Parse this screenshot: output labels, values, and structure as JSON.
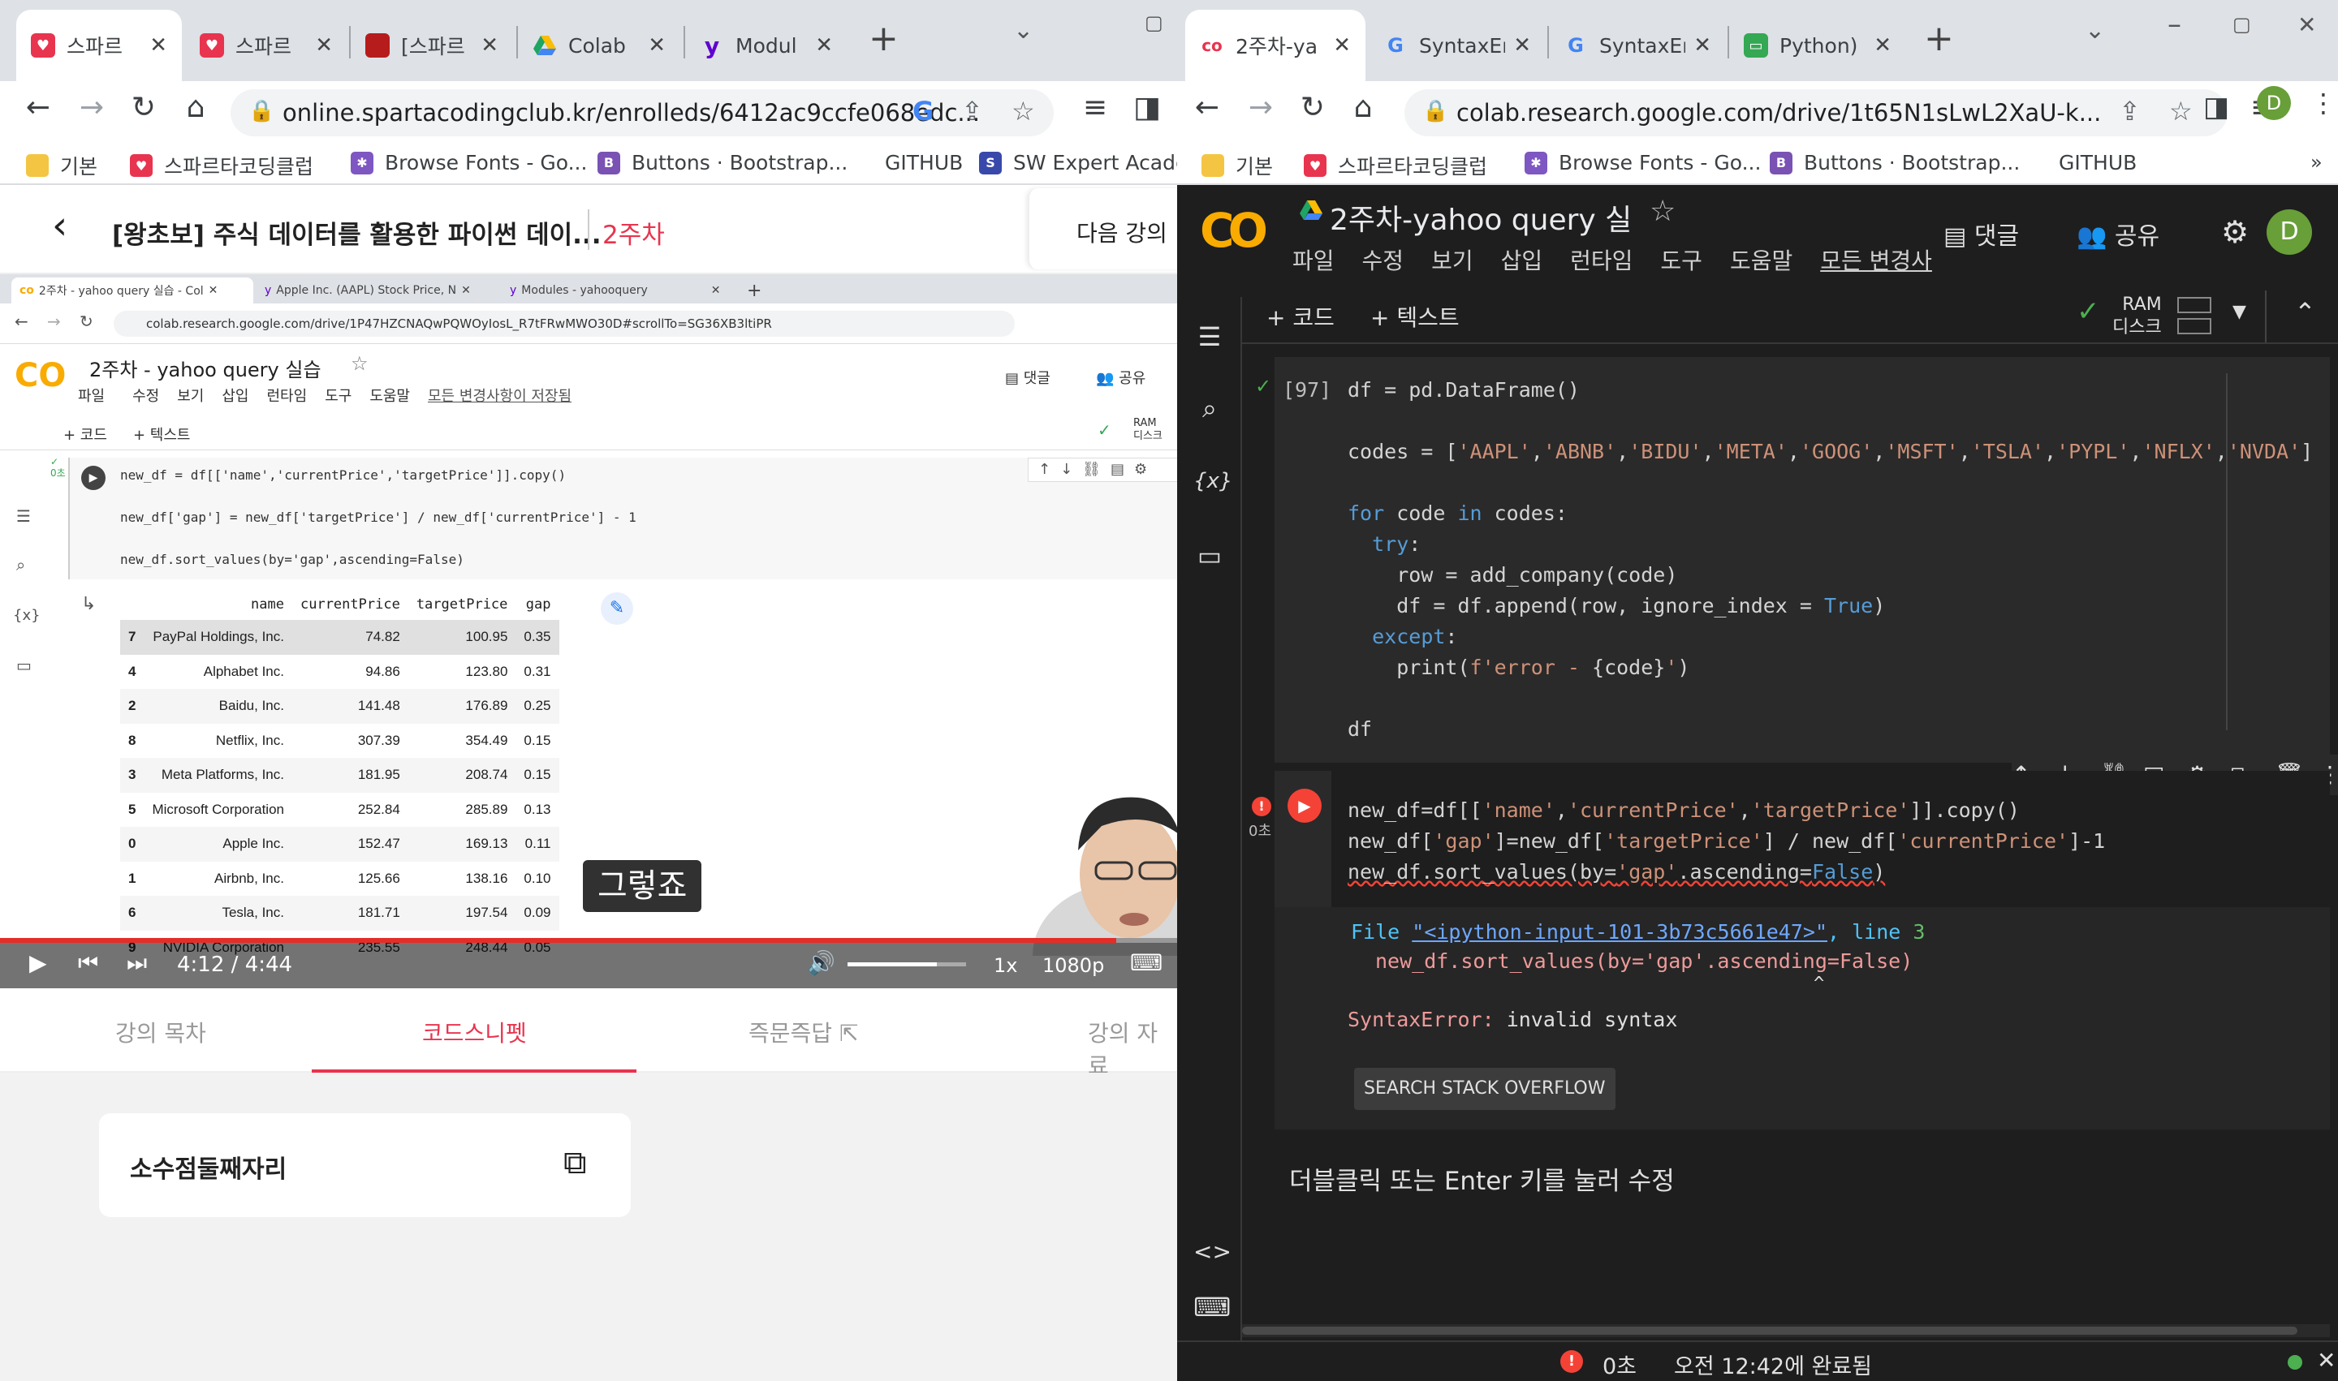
{
  "left_browser": {
    "tabs": [
      "스파르",
      "스파르",
      "[스파르",
      "Colab",
      "Modul"
    ],
    "url": "online.spartacodingclub.kr/enrolleds/6412ac9ccfe068edc...",
    "bookmarks": [
      "기본",
      "스파르타코딩클럽",
      "Browse Fonts - Go...",
      "Buttons · Bootstrap...",
      "GITHUB",
      "SW Expert Acader"
    ]
  },
  "lecture": {
    "title": "[왕초보] 주식 데이터를 활용한 파이썬 데이...",
    "week": "2주차",
    "next_label": "다음 강의",
    "tabs": [
      "강의 목차",
      "코드스니펫",
      "즉문즉답",
      "강의 자료"
    ],
    "snippet_title": "소수점둘째자리"
  },
  "video": {
    "tabs": [
      "2주차 - yahoo query 실습 - Col",
      "Apple Inc. (AAPL) Stock Price, N",
      "Modules - yahooquery"
    ],
    "url": "colab.research.google.com/drive/1P47HZCNAQwPQWOyIosL_R7tFRwMWO30D#scrollTo=SG36XB3ltiPR",
    "notebook_title": "2주차 - yahoo query 실습",
    "menu": [
      "파일",
      "수정",
      "보기",
      "삽입",
      "런타임",
      "도구",
      "도움말",
      "모든 변경사항이 저장됨"
    ],
    "comment_label": "댓글",
    "share_label": "공유",
    "add_code": "+ 코드",
    "add_text": "+ 텍스트",
    "ram_label": "RAM",
    "disk_label": "디스크",
    "exec_time": "0초",
    "code_lines": [
      "new_df = df[['name','currentPrice','targetPrice']].copy()",
      "new_df['gap'] = new_df['targetPrice'] / new_df['currentPrice'] - 1",
      "new_df.sort_values(by='gap',ascending=False)"
    ],
    "table_headers": [
      "",
      "name",
      "currentPrice",
      "targetPrice",
      "gap"
    ],
    "table_rows": [
      [
        "7",
        "PayPal Holdings, Inc.",
        "74.82",
        "100.95",
        "0.35"
      ],
      [
        "4",
        "Alphabet Inc.",
        "94.86",
        "123.80",
        "0.31"
      ],
      [
        "2",
        "Baidu, Inc.",
        "141.48",
        "176.89",
        "0.25"
      ],
      [
        "8",
        "Netflix, Inc.",
        "307.39",
        "354.49",
        "0.15"
      ],
      [
        "3",
        "Meta Platforms, Inc.",
        "181.95",
        "208.74",
        "0.15"
      ],
      [
        "5",
        "Microsoft Corporation",
        "252.84",
        "285.89",
        "0.13"
      ],
      [
        "0",
        "Apple Inc.",
        "152.47",
        "169.13",
        "0.11"
      ],
      [
        "1",
        "Airbnb, Inc.",
        "125.66",
        "138.16",
        "0.10"
      ],
      [
        "6",
        "Tesla, Inc.",
        "181.71",
        "197.54",
        "0.09"
      ],
      [
        "9",
        "NVIDIA Corporation",
        "235.55",
        "248.44",
        "0.05"
      ]
    ],
    "subtitle": "그렇죠",
    "time_current": "4:12",
    "time_sep": "/",
    "time_total": "4:44",
    "speed": "1x",
    "quality": "1080p",
    "progress": 0.948,
    "volume": 0.75
  },
  "right_browser": {
    "tabs": [
      "2주차-ya",
      "SyntaxEr",
      "SyntaxEr",
      "Python)"
    ],
    "url": "colab.research.google.com/drive/1t65N1sLwL2XaU-k...",
    "bookmarks": [
      "기본",
      "스파르타코딩클럽",
      "Browse Fonts - Go...",
      "Buttons · Bootstrap...",
      "GITHUB"
    ],
    "profile_initial": "D"
  },
  "colab": {
    "title": "2주차-yahoo query 실",
    "menu": [
      "파일",
      "수정",
      "보기",
      "삽입",
      "런타임",
      "도구",
      "도움말",
      "모든 변경사"
    ],
    "comment_label": "댓글",
    "share_label": "공유",
    "add_code": "+ 코드",
    "add_text": "+ 텍스트",
    "ram_label": "RAM",
    "disk_label": "디스크",
    "cell1_label": "[97]",
    "cell2_time": "0초",
    "error_file_prefix": "File ",
    "error_file_link": "\"<ipython-input-101-3b73c5661e47>\"",
    "error_file_suffix": ", line ",
    "error_line_no": "3",
    "error_code": "new_df.sort_values(by='gap'.ascending=False)",
    "error_caret": "^",
    "error_type": "SyntaxError:",
    "error_message": "invalid syntax",
    "so_button": "SEARCH STACK OVERFLOW",
    "text_cell_hint": "더블클릭 또는 Enter 키를 눌러 수정",
    "status_time": "0초",
    "status_message": "오전 12:42에 완료됨"
  },
  "colors": {
    "accent_red": "#e8344e",
    "colab_orange": "#f9ab00",
    "error_red": "#f44336",
    "keyword_blue": "#569cd6",
    "string_orange": "#ce9178"
  }
}
